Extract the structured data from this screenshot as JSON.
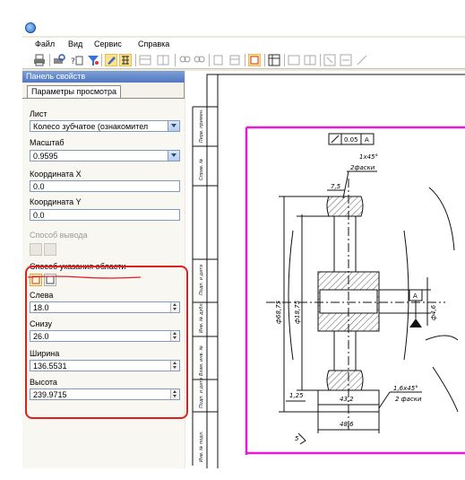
{
  "menu": [
    "Файл",
    "Вид",
    "Сервис",
    "Справка"
  ],
  "panel": {
    "title": "Панель свойств",
    "tab": "Параметры просмотра",
    "sheet_label": "Лист",
    "sheet_value": "Колесо зубчатое (ознакомител",
    "scale_label": "Масштаб",
    "scale_value": "0.9595",
    "coord_x_label": "Координата X",
    "coord_x_value": "0.0",
    "coord_y_label": "Координата Y",
    "coord_y_value": "0.0",
    "output_label": "Способ вывода",
    "area_label": "Способ указания области",
    "left_label": "Слева",
    "left_value": "18.0",
    "bottom_label": "Снизу",
    "bottom_value": "26.0",
    "width_label": "Ширина",
    "width_value": "136.5531",
    "height_label": "Высота",
    "height_value": "239.9715"
  },
  "drawing": {
    "tolerance_value": "0.05",
    "datum": "A",
    "chamfer_top": "1х45°",
    "chamfer_top_note": "2фаски",
    "dim_top": "7,5",
    "dim_d1": "ф68,75",
    "dim_d2": "ф18,75",
    "dim_d3": "ф4,6",
    "dim_bottom_small": "1,25",
    "dim_width": "43,2",
    "chamfer_bottom": "1,6х45°",
    "chamfer_bottom_note": "2 фаски",
    "dim_total": "48,6",
    "stamp_labels": [
      "Перв. примен.",
      "Справ. №",
      "Подп. и дата",
      "Инв. № дубл.",
      "Взам. инв. №",
      "Подп. и дата",
      "Инв. № подл."
    ]
  },
  "colors": {
    "frame_magenta": "#e81ad6",
    "annotation_red": "#e02020",
    "panel_header": "#5f86c9"
  }
}
